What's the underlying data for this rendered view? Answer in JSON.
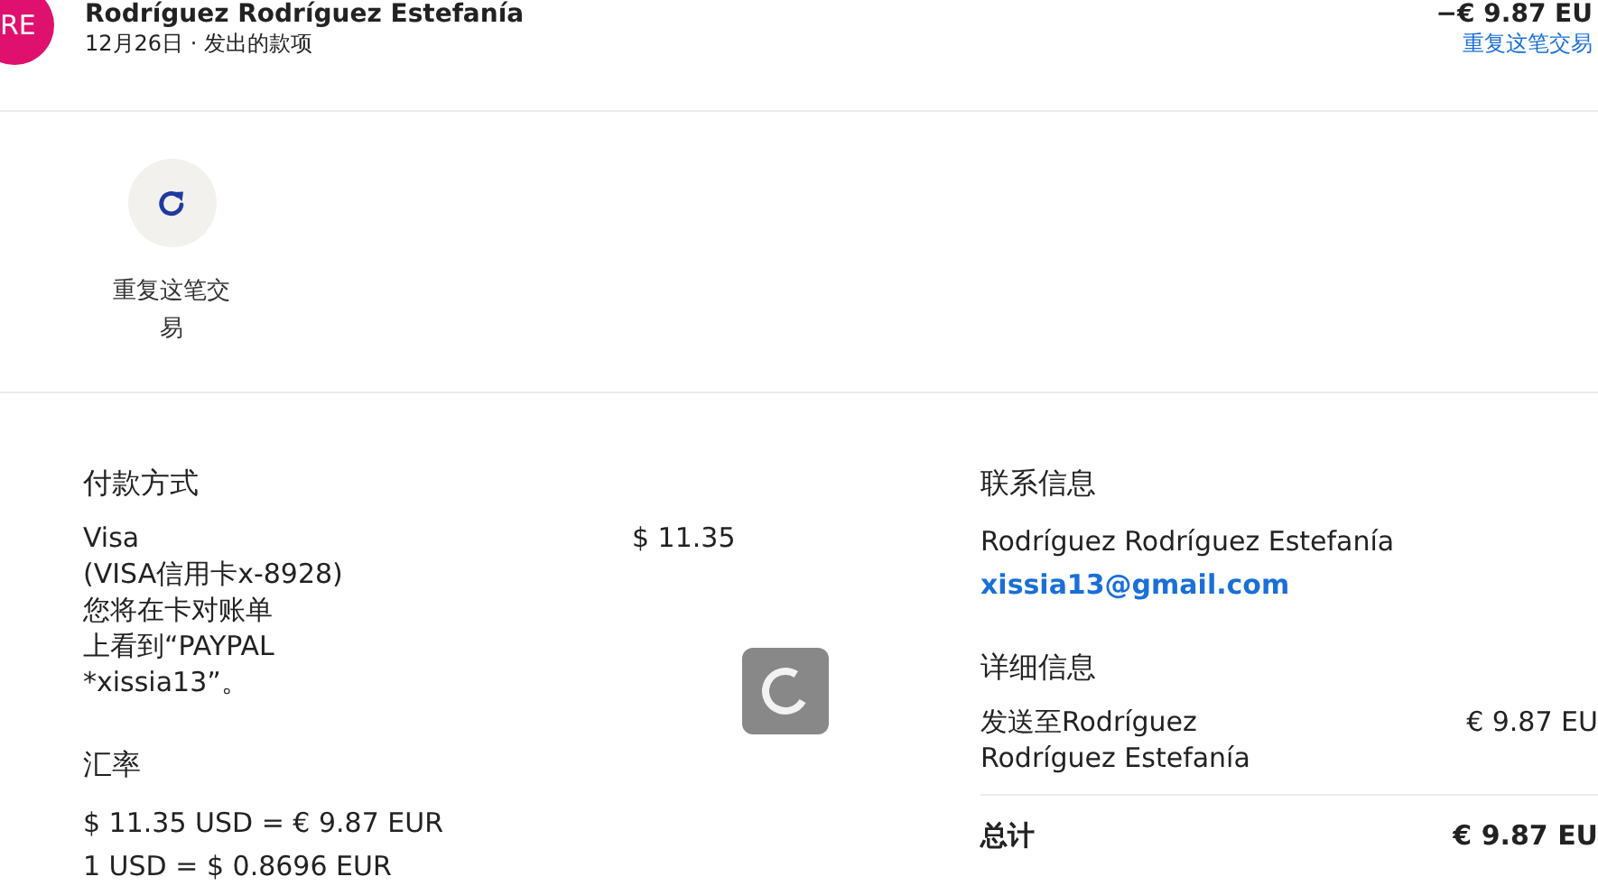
{
  "header": {
    "avatar": "RE",
    "name": "Rodríguez Rodríguez Estefanía",
    "date": "12月26日",
    "separator": "·",
    "type": "发出的款项",
    "amount": "−€ 9.87 EU",
    "link": "重复这笔交易"
  },
  "actions": [
    {
      "label": "重复这笔交易"
    }
  ],
  "payment": {
    "heading": "付款方式",
    "lines": [
      "Visa",
      "(VISA信用卡x-8928)",
      "您将在卡对账单",
      "上看到“PAYPAL",
      "*xissia13”。"
    ],
    "amount": "$ 11.35"
  },
  "exchange": {
    "heading": "汇率",
    "lines": [
      "$ 11.35 USD = € 9.87 EUR",
      "1 USD = $ 0.8696 EUR"
    ]
  },
  "contact": {
    "heading": "联系信息",
    "name": "Rodríguez Rodríguez Estefanía",
    "email": "xissia13@gmail.com"
  },
  "details": {
    "heading": "详细信息",
    "rows": [
      {
        "label": "发送至Rodríguez Rodríguez Estefanía",
        "amount": "€ 9.87 EU"
      }
    ],
    "total_label": "总计",
    "total": "€ 9.87 EU"
  }
}
